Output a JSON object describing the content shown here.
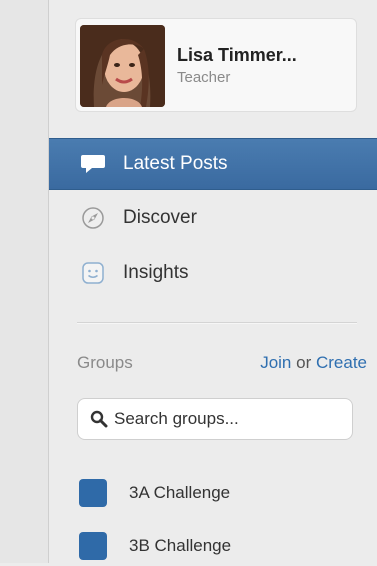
{
  "profile": {
    "name": "Lisa Timmer...",
    "role": "Teacher"
  },
  "nav": {
    "items": [
      {
        "label": "Latest Posts",
        "icon": "speech-bubble-icon",
        "active": true
      },
      {
        "label": "Discover",
        "icon": "compass-icon",
        "active": false
      },
      {
        "label": "Insights",
        "icon": "smiley-icon",
        "active": false
      }
    ]
  },
  "groups": {
    "label": "Groups",
    "join_label": "Join",
    "or_label": "or",
    "create_label": "Create",
    "search": {
      "placeholder": "Search groups...",
      "value": ""
    },
    "items": [
      {
        "name": "3A Challenge",
        "color": "#2f6aa8"
      },
      {
        "name": "3B Challenge",
        "color": "#2f6aa8"
      }
    ]
  },
  "colors": {
    "accent": "#3f72a8",
    "link": "#2f6fb0",
    "group_swatch": "#2f6aa8"
  }
}
